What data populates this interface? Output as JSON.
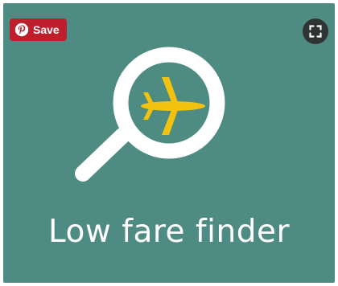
{
  "pin": {
    "save_label": "Save",
    "button_icon": "pinterest-icon",
    "expand_icon": "expand-icon"
  },
  "card": {
    "headline": "Low fare finder",
    "graphic": "magnifier-airplane-icon"
  },
  "colors": {
    "background": "#4e8b82",
    "pin_red": "#bd1f2d",
    "airplane": "#f2c20e",
    "text": "#ffffff"
  }
}
